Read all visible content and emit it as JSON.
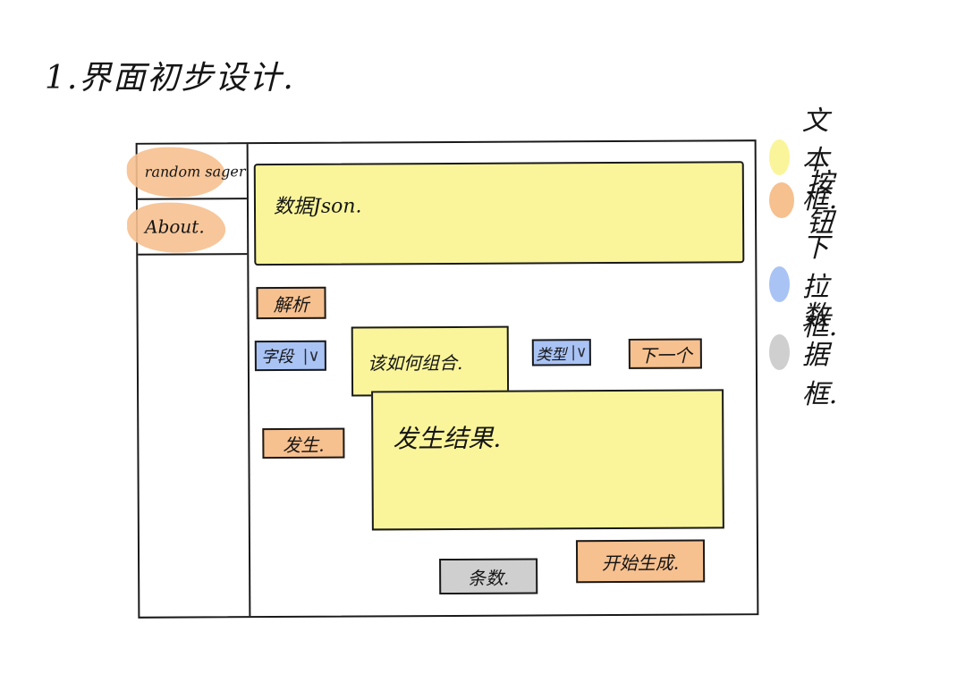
{
  "title": "1.界面初步设计.",
  "colors": {
    "textbox": "#faf59a",
    "button": "#f6c08f",
    "dropdown": "#a9c3f5",
    "numberbox": "#cfcfcf",
    "ink": "#1a1a1a"
  },
  "sidebar": {
    "items": [
      {
        "label": "random sager"
      },
      {
        "label": "About."
      }
    ]
  },
  "main": {
    "json_input": {
      "text": "数据Json."
    },
    "parse_button": {
      "label": "解析"
    },
    "field_dropdown": {
      "label": "字段",
      "caret": "|∨"
    },
    "field_textbox": {
      "text": "该如何组合."
    },
    "type_dropdown": {
      "label": "类型",
      "caret": "|∨"
    },
    "next_button": {
      "label": "下一个"
    },
    "generate_button": {
      "label": "发生."
    },
    "result_box": {
      "text": "发生结果."
    },
    "count_box": {
      "label": "条数."
    },
    "start_button": {
      "label": "开始生成."
    }
  },
  "legend": [
    {
      "label": "文本框.",
      "color": "#faf59a"
    },
    {
      "label": "按钮",
      "color": "#f6c08f"
    },
    {
      "label": "下拉框.",
      "color": "#a9c3f5"
    },
    {
      "label": "数据框.",
      "color": "#cfcfcf"
    }
  ]
}
